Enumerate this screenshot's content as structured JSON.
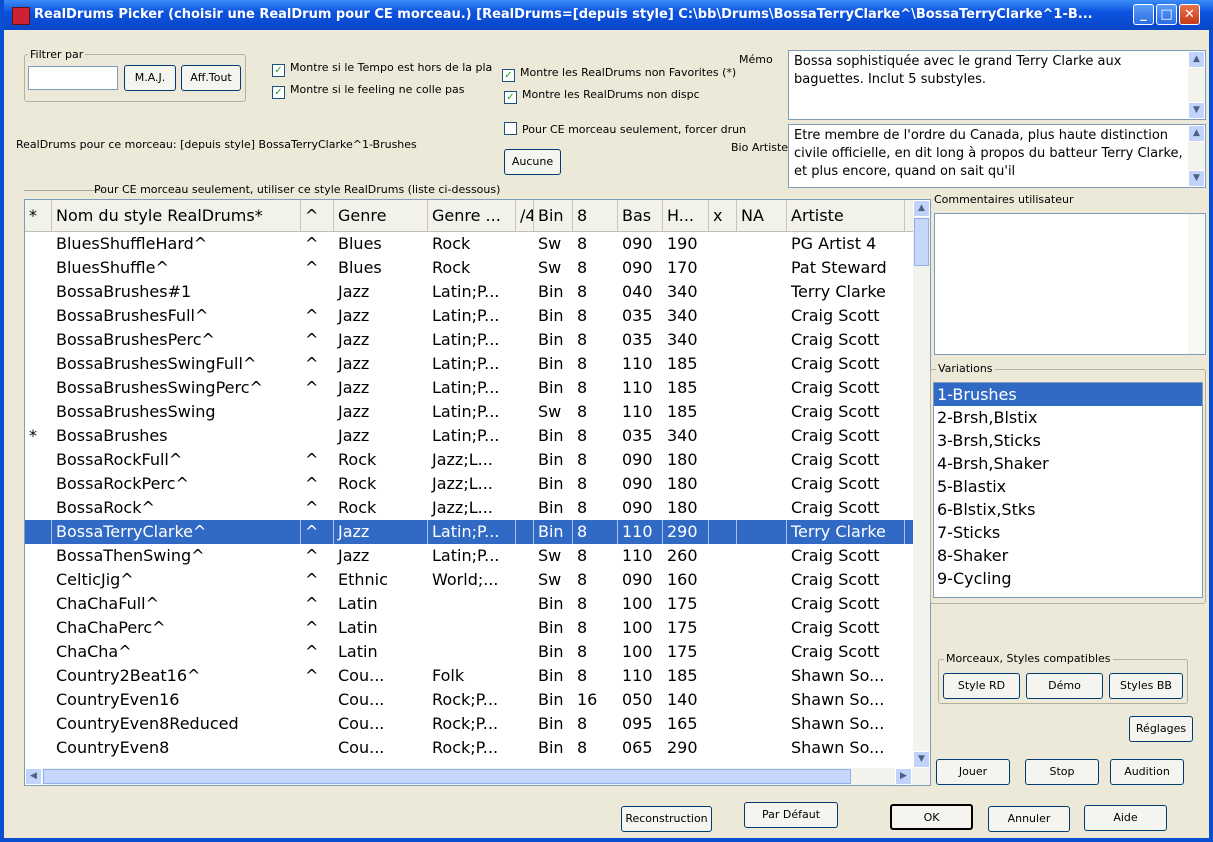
{
  "window": {
    "title": "RealDrums Picker (choisir une RealDrum pour CE morceau.) [RealDrums=[depuis style] C:\\bb\\Drums\\BossaTerryClarke^\\BossaTerryClarke^1-B..."
  },
  "filter": {
    "legend": "Filtrer par",
    "value": "",
    "update_label": "M.A.J.",
    "show_all_label": "Aff.Tout"
  },
  "checkboxes": {
    "tempo": "Montre si le Tempo est hors de la pla",
    "feeling": "Montre si le feeling ne colle pas",
    "non_favorites": "Montre les RealDrums non Favorites (*)",
    "non_available": "Montre les RealDrums non dispc",
    "force": "Pour CE morceau seulement, forcer drun"
  },
  "current_label": "RealDrums pour ce morceau: [depuis style] BossaTerryClarke^1-Brushes",
  "none_button": "Aucune",
  "use_style_note": "Pour CE morceau seulement, utiliser ce style RealDrums (liste ci-dessous)",
  "memo": {
    "label": "Mémo",
    "text": "Bossa sophistiquée avec le grand Terry Clarke aux baguettes.  Inclut 5 substyles."
  },
  "bio": {
    "label": "Bio Artiste",
    "text": "Etre membre de l'ordre du Canada, plus haute distinction civile officielle, en dit long à propos du batteur Terry Clarke, et plus encore, quand on sait qu'il"
  },
  "comments_label": "Commentaires utilisateur",
  "table": {
    "columns": [
      "*",
      "Nom du style RealDrums*",
      "^",
      "Genre",
      "Genre ...",
      "/4",
      "Bin",
      "8",
      "Bas",
      "H...",
      "x",
      "NA",
      "Artiste"
    ],
    "rows": [
      [
        "",
        "BluesShuffleHard^",
        "^",
        "Blues",
        "Rock",
        "",
        "Sw",
        "8",
        "090",
        "190",
        "",
        "",
        "PG Artist 4"
      ],
      [
        "",
        "BluesShuffle^",
        "^",
        "Blues",
        "Rock",
        "",
        "Sw",
        "8",
        "090",
        "170",
        "",
        "",
        "Pat Steward"
      ],
      [
        "",
        "BossaBrushes#1",
        "",
        "Jazz",
        "Latin;P...",
        "",
        "Bin",
        "8",
        "040",
        "340",
        "",
        "",
        "Terry Clarke"
      ],
      [
        "",
        "BossaBrushesFull^",
        "^",
        "Jazz",
        "Latin;P...",
        "",
        "Bin",
        "8",
        "035",
        "340",
        "",
        "",
        "Craig Scott"
      ],
      [
        "",
        "BossaBrushesPerc^",
        "^",
        "Jazz",
        "Latin;P...",
        "",
        "Bin",
        "8",
        "035",
        "340",
        "",
        "",
        "Craig Scott"
      ],
      [
        "",
        "BossaBrushesSwingFull^",
        "^",
        "Jazz",
        "Latin;P...",
        "",
        "Bin",
        "8",
        "110",
        "185",
        "",
        "",
        "Craig Scott"
      ],
      [
        "",
        "BossaBrushesSwingPerc^",
        "^",
        "Jazz",
        "Latin;P...",
        "",
        "Bin",
        "8",
        "110",
        "185",
        "",
        "",
        "Craig Scott"
      ],
      [
        "",
        "BossaBrushesSwing",
        "",
        "Jazz",
        "Latin;P...",
        "",
        "Sw",
        "8",
        "110",
        "185",
        "",
        "",
        "Craig Scott"
      ],
      [
        "*",
        "BossaBrushes",
        "",
        "Jazz",
        "Latin;P...",
        "",
        "Bin",
        "8",
        "035",
        "340",
        "",
        "",
        "Craig Scott"
      ],
      [
        "",
        "BossaRockFull^",
        "^",
        "Rock",
        "Jazz;L...",
        "",
        "Bin",
        "8",
        "090",
        "180",
        "",
        "",
        "Craig Scott"
      ],
      [
        "",
        "BossaRockPerc^",
        "^",
        "Rock",
        "Jazz;L...",
        "",
        "Bin",
        "8",
        "090",
        "180",
        "",
        "",
        "Craig Scott"
      ],
      [
        "",
        "BossaRock^",
        "^",
        "Rock",
        "Jazz;L...",
        "",
        "Bin",
        "8",
        "090",
        "180",
        "",
        "",
        "Craig Scott"
      ],
      [
        "",
        "BossaTerryClarke^",
        "^",
        "Jazz",
        "Latin;P...",
        "",
        "Bin",
        "8",
        "110",
        "290",
        "",
        "",
        "Terry Clarke"
      ],
      [
        "",
        "BossaThenSwing^",
        "^",
        "Jazz",
        "Latin;P...",
        "",
        "Sw",
        "8",
        "110",
        "260",
        "",
        "",
        "Craig Scott"
      ],
      [
        "",
        "CelticJig^",
        "^",
        "Ethnic",
        "World;...",
        "",
        "Sw",
        "8",
        "090",
        "160",
        "",
        "",
        "Craig Scott"
      ],
      [
        "",
        "ChaChaFull^",
        "^",
        "Latin",
        "",
        "",
        "Bin",
        "8",
        "100",
        "175",
        "",
        "",
        "Craig Scott"
      ],
      [
        "",
        "ChaChaPerc^",
        "^",
        "Latin",
        "",
        "",
        "Bin",
        "8",
        "100",
        "175",
        "",
        "",
        "Craig Scott"
      ],
      [
        "",
        "ChaCha^",
        "^",
        "Latin",
        "",
        "",
        "Bin",
        "8",
        "100",
        "175",
        "",
        "",
        "Craig Scott"
      ],
      [
        "",
        "Country2Beat16^",
        "^",
        "Cou...",
        "Folk",
        "",
        "Bin",
        "8",
        "110",
        "185",
        "",
        "",
        "Shawn So..."
      ],
      [
        "",
        "CountryEven16",
        "",
        "Cou...",
        "Rock;P...",
        "",
        "Bin",
        "16",
        "050",
        "140",
        "",
        "",
        "Shawn So..."
      ],
      [
        "",
        "CountryEven8Reduced",
        "",
        "Cou...",
        "Rock;P...",
        "",
        "Bin",
        "8",
        "095",
        "165",
        "",
        "",
        "Shawn So..."
      ],
      [
        "",
        "CountryEven8",
        "",
        "Cou...",
        "Rock;P...",
        "",
        "Bin",
        "8",
        "065",
        "290",
        "",
        "",
        "Shawn So..."
      ]
    ],
    "selected_index": 12
  },
  "variations": {
    "legend": "Variations",
    "items": [
      "1-Brushes",
      "2-Brsh,Blstix",
      "3-Brsh,Sticks",
      "4-Brsh,Shaker",
      "5-Blastix",
      "6-Blstix,Stks",
      "7-Sticks",
      "8-Shaker",
      "9-Cycling"
    ],
    "selected_index": 0
  },
  "compatible": {
    "legend": "Morceaux, Styles compatibles",
    "style_rd": "Style RD",
    "demo": "Démo",
    "styles_bb": "Styles BB"
  },
  "buttons": {
    "settings": "Réglages",
    "play": "Jouer",
    "stop": "Stop",
    "audition": "Audition",
    "rebuild": "Reconstruction",
    "default": "Par Défaut",
    "ok": "OK",
    "cancel": "Annuler",
    "help": "Aide"
  }
}
